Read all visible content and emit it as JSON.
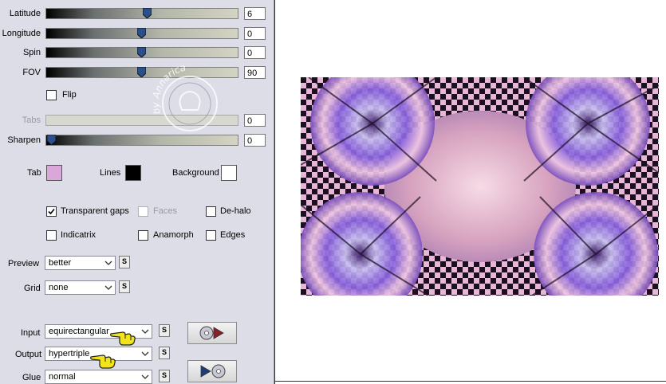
{
  "sliders": [
    {
      "key": "latitude",
      "label": "Latitude",
      "value": "6",
      "level": 0.53
    },
    {
      "key": "longitude",
      "label": "Longitude",
      "value": "0",
      "level": 0.5
    },
    {
      "key": "spin",
      "label": "Spin",
      "value": "0",
      "level": 0.5
    },
    {
      "key": "fov",
      "label": "FOV",
      "value": "90",
      "level": 0.5
    },
    {
      "key": "tabs",
      "label": "Tabs",
      "value": "0",
      "level": 0.0
    },
    {
      "key": "sharpen",
      "label": "Sharpen",
      "value": "0",
      "level": 0.0
    }
  ],
  "flip": {
    "label": "Flip",
    "checked": false
  },
  "colors": {
    "tab": {
      "label": "Tab",
      "color": "#d9a8d9"
    },
    "lines": {
      "label": "Lines",
      "color": "#000000"
    },
    "background": {
      "label": "Background",
      "color": "#ffffff"
    }
  },
  "options": {
    "transparent_gaps": {
      "label": "Transparent gaps",
      "checked": true
    },
    "faces": {
      "label": "Faces",
      "checked": false
    },
    "dehalo": {
      "label": "De-halo",
      "checked": false
    },
    "indicatrix": {
      "label": "Indicatrix",
      "checked": false
    },
    "anamorph": {
      "label": "Anamorph",
      "checked": false
    },
    "edges": {
      "label": "Edges",
      "checked": false
    }
  },
  "selects": {
    "preview": {
      "label": "Preview",
      "value": "better"
    },
    "grid": {
      "label": "Grid",
      "value": "none"
    },
    "input": {
      "label": "Input",
      "value": "equirectangular"
    },
    "output": {
      "label": "Output",
      "value": "hypertriple"
    },
    "glue": {
      "label": "Glue",
      "value": "normal"
    }
  },
  "small_button_label": "S",
  "watermark": {
    "text": "by Annarica"
  },
  "accent": {
    "thumb": "#2a4f8a",
    "panel": "#dcdde6",
    "pointer": "#f2e31a"
  }
}
